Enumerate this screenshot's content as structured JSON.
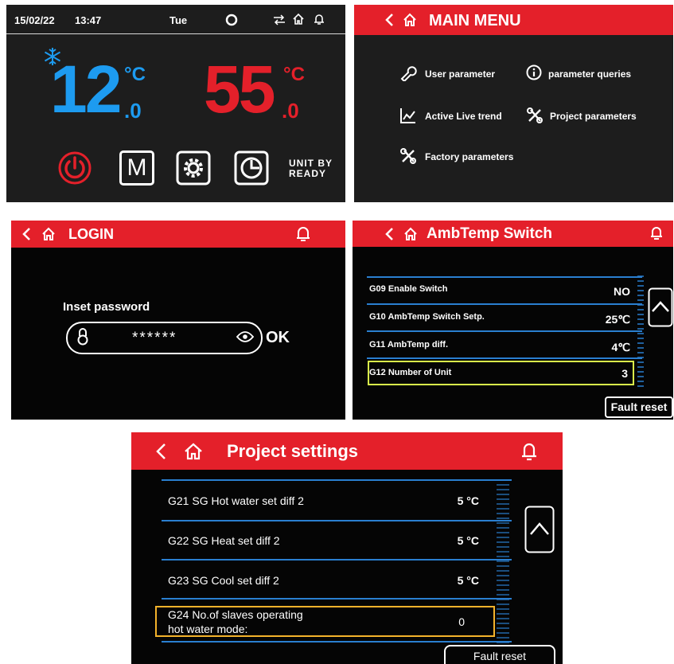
{
  "home": {
    "date": "15/02/22",
    "time": "13:47",
    "weekday": "Tue",
    "left_temp_int": "12",
    "left_temp_dec": ".0",
    "left_unit": "°C",
    "right_temp_int": "55",
    "right_temp_dec": ".0",
    "right_unit": "°C",
    "mode_button": "M",
    "status_line1": "UNIT BY",
    "status_line2": "READY",
    "colors": {
      "cold": "#1d9bf0",
      "hot": "#e4202a"
    }
  },
  "main_menu": {
    "title": "MAIN MENU",
    "items": [
      {
        "label": "User parameter",
        "icon": "wrench-icon"
      },
      {
        "label": "parameter queries",
        "icon": "info-icon"
      },
      {
        "label": "Active Live trend",
        "icon": "trend-chart-icon"
      },
      {
        "label": "Project parameters",
        "icon": "tools-icon"
      },
      {
        "label": "Factory parameters",
        "icon": "tools-icon"
      }
    ]
  },
  "login": {
    "title": "LOGIN",
    "prompt": "Inset password",
    "password_mask": "******",
    "ok_label": "OK"
  },
  "ambtemp": {
    "title": "AmbTemp Switch",
    "rows": [
      {
        "label": "G09 Enable Switch",
        "value": "NO"
      },
      {
        "label": "G10 AmbTemp Switch Setp.",
        "value": "25℃"
      },
      {
        "label": "G11 AmbTemp diff.",
        "value": "4℃"
      },
      {
        "label": "G12 Number of Unit",
        "value": "3"
      }
    ],
    "fault_reset": "Fault reset"
  },
  "project": {
    "title": "Project settings",
    "rows": [
      {
        "label": "G21 SG Hot water set diff 2",
        "value": "5 °C"
      },
      {
        "label": "G22 SG Heat set diff 2",
        "value": "5 °C"
      },
      {
        "label": "G23 SG Cool set diff 2",
        "value": "5 °C"
      },
      {
        "label_line1": "G24 No.of slaves operating",
        "label_line2": "hot water mode:",
        "value": "0"
      }
    ],
    "fault_reset": "Fault reset"
  }
}
